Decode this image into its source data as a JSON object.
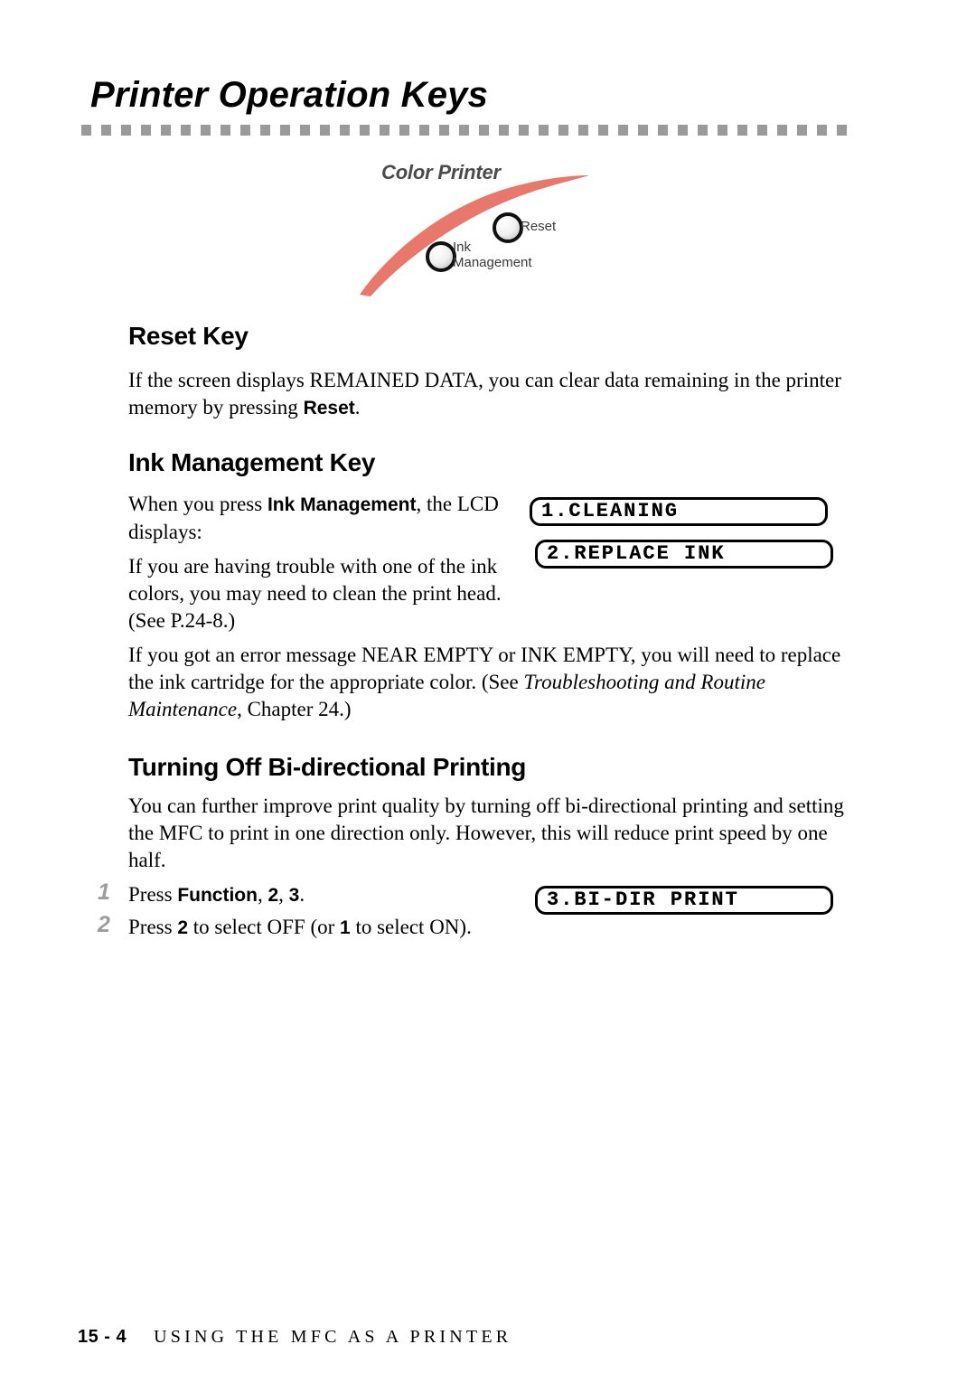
{
  "page": {
    "title": "Printer Operation Keys"
  },
  "illustration": {
    "caption": "Color Printer",
    "reset_label": "Reset",
    "ink_label_line1": "Ink",
    "ink_label_line2": "Management",
    "arc_color": "#E8786B",
    "button_ring_color": "#111111"
  },
  "sections": [
    {
      "heading": "Reset Key",
      "paragraphs": [
        {
          "parts": [
            {
              "text": "If the screen displays REMAINED DATA, you can clear data remaining in the printer memory by pressing ",
              "style": "normal"
            },
            {
              "text": "Reset",
              "style": "bold"
            },
            {
              "text": ".",
              "style": "normal"
            }
          ]
        }
      ]
    },
    {
      "heading": "Ink Management Key",
      "paragraphs": [
        {
          "parts": [
            {
              "text": "When you press ",
              "style": "normal"
            },
            {
              "text": "Ink Management",
              "style": "bold"
            },
            {
              "text": ", the LCD displays:",
              "style": "normal"
            }
          ]
        },
        {
          "parts": [
            {
              "text": "If you are having trouble with one of the ink colors, you may need to clean the print head. (See P.24-8.)",
              "style": "normal"
            }
          ]
        },
        {
          "parts": [
            {
              "text": "If you got an error message NEAR EMPTY or INK EMPTY, you will need to replace the ink cartridge for the appropriate color. (See ",
              "style": "normal"
            },
            {
              "text": "Troubleshooting and Routine Maintenance",
              "style": "italic"
            },
            {
              "text": ", Chapter 24.)",
              "style": "normal"
            }
          ]
        }
      ]
    },
    {
      "heading": "Turning Off Bi-directional Printing",
      "paragraphs": [
        {
          "parts": [
            {
              "text": "You can further improve print quality by turning off bi-directional printing and setting the MFC to print in one direction only. However, this will reduce print speed by one half.",
              "style": "normal"
            }
          ]
        }
      ]
    }
  ],
  "lcd_displays": [
    {
      "text": "1.CLEANING"
    },
    {
      "text": "2.REPLACE INK"
    },
    {
      "text": "3.BI-DIR PRINT"
    }
  ],
  "steps": [
    {
      "number": "1",
      "parts": [
        {
          "text": "Press ",
          "style": "normal"
        },
        {
          "text": "Function",
          "style": "bold"
        },
        {
          "text": ", ",
          "style": "normal"
        },
        {
          "text": "2",
          "style": "bold"
        },
        {
          "text": ", ",
          "style": "normal"
        },
        {
          "text": "3",
          "style": "bold"
        },
        {
          "text": ".",
          "style": "normal"
        }
      ]
    },
    {
      "number": "2",
      "parts": [
        {
          "text": "Press ",
          "style": "normal"
        },
        {
          "text": "2",
          "style": "bold"
        },
        {
          "text": " to select OFF (or ",
          "style": "normal"
        },
        {
          "text": "1",
          "style": "bold"
        },
        {
          "text": " to select ON).",
          "style": "normal"
        }
      ]
    }
  ],
  "footer": {
    "page_number": "15 - 4",
    "running_head": "USING THE MFC AS A PRINTER"
  }
}
